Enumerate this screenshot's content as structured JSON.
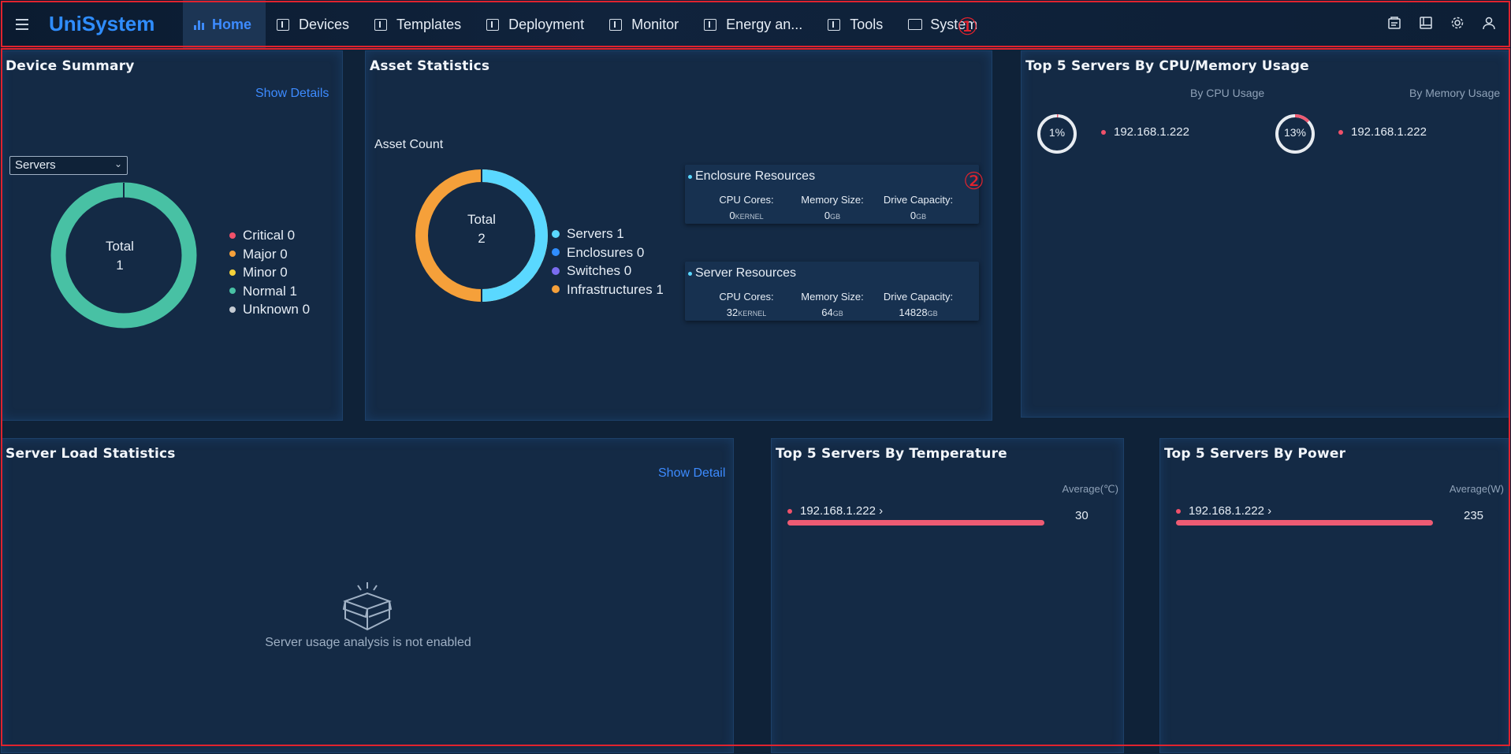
{
  "brand": {
    "name": "UniSystem"
  },
  "nav": {
    "items": [
      {
        "label": "Home"
      },
      {
        "label": "Devices"
      },
      {
        "label": "Templates"
      },
      {
        "label": "Deployment"
      },
      {
        "label": "Monitor"
      },
      {
        "label": "Energy an..."
      },
      {
        "label": "Tools"
      },
      {
        "label": "System"
      }
    ],
    "active": "Home",
    "right_icons": [
      "task-icon",
      "book-icon",
      "gear-icon",
      "user-icon"
    ]
  },
  "annotations": {
    "one": "①",
    "two": "②",
    "color": "#e0232e"
  },
  "device_summary": {
    "title": "Device Summary",
    "show_details": "Show Details",
    "select_value": "Servers",
    "total_label": "Total",
    "total_value": "1",
    "legend": [
      {
        "label": "Critical 0",
        "color": "#f0516a"
      },
      {
        "label": "Major 0",
        "color": "#f5a03a"
      },
      {
        "label": "Minor 0",
        "color": "#f5d23a"
      },
      {
        "label": "Normal 1",
        "color": "#48c1a4"
      },
      {
        "label": "Unknown 0",
        "color": "#c5cbd3"
      }
    ]
  },
  "asset_statistics": {
    "title": "Asset Statistics",
    "asset_count_label": "Asset Count",
    "total_label": "Total",
    "total_value": "2",
    "legend": [
      {
        "label": "Servers 1",
        "color": "#5ad8ff"
      },
      {
        "label": "Enclosures 0",
        "color": "#2f8dff"
      },
      {
        "label": "Switches 0",
        "color": "#7a6cf0"
      },
      {
        "label": "Infrastructures 1",
        "color": "#f5a03a"
      }
    ],
    "enclosure": {
      "title": "Enclosure Resources",
      "cpu_label": "CPU Cores:",
      "cpu_value": "0",
      "cpu_unit": "KERNEL",
      "mem_label": "Memory Size:",
      "mem_value": "0",
      "mem_unit": "GB",
      "drive_label": "Drive Capacity:",
      "drive_value": "0",
      "drive_unit": "GB"
    },
    "server": {
      "title": "Server Resources",
      "cpu_label": "CPU Cores:",
      "cpu_value": "32",
      "cpu_unit": "KERNEL",
      "mem_label": "Memory Size:",
      "mem_value": "64",
      "mem_unit": "GB",
      "drive_label": "Drive Capacity:",
      "drive_value": "14828",
      "drive_unit": "GB"
    }
  },
  "top_cpu_mem": {
    "title": "Top 5 Servers By CPU/Memory Usage",
    "by_cpu_label": "By CPU Usage",
    "by_mem_label": "By Memory Usage",
    "cpu": {
      "percent_text": "1%",
      "fraction": 0.01,
      "ip": "192.168.1.222"
    },
    "mem": {
      "percent_text": "13%",
      "fraction": 0.13,
      "ip": "192.168.1.222"
    }
  },
  "server_load": {
    "title": "Server Load Statistics",
    "show_detail": "Show Detail",
    "empty_text": "Server usage analysis is not enabled"
  },
  "top_temperature": {
    "title": "Top 5 Servers By Temperature",
    "avg_label": "Average(℃)",
    "ip": "192.168.1.222 ›",
    "value": "30"
  },
  "top_power": {
    "title": "Top 5 Servers By Power",
    "avg_label": "Average(W)",
    "ip": "192.168.1.222 ›",
    "value": "235"
  }
}
